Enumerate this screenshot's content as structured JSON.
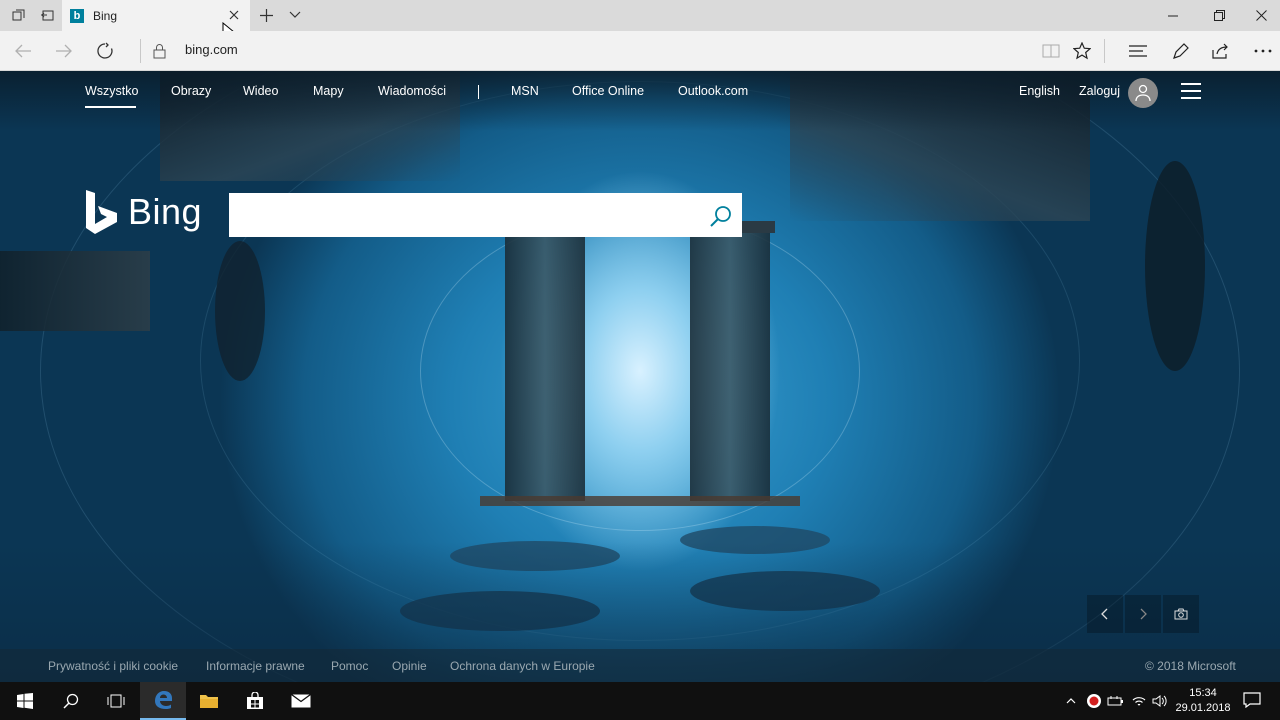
{
  "browser": {
    "tab": {
      "title": "Bing"
    },
    "address": {
      "url": "bing.com"
    }
  },
  "bing": {
    "nav": {
      "items": [
        "Wszystko",
        "Obrazy",
        "Wideo",
        "Mapy",
        "Wiadomości",
        "MSN",
        "Office Online",
        "Outlook.com"
      ],
      "language": "English",
      "signin": "Zaloguj"
    },
    "logo_text": "Bing",
    "search": {
      "value": "",
      "placeholder": ""
    },
    "footer": {
      "links": [
        "Prywatność i pliki cookie",
        "Informacje prawne",
        "Pomoc",
        "Opinie",
        "Ochrona danych w Europie"
      ],
      "copyright": "© 2018 Microsoft"
    }
  },
  "taskbar": {
    "time": "15:34",
    "date": "29.01.2018"
  },
  "colors": {
    "bing_teal": "#00809d",
    "edge_blue": "#3277bc",
    "taskbar": "#101010"
  }
}
